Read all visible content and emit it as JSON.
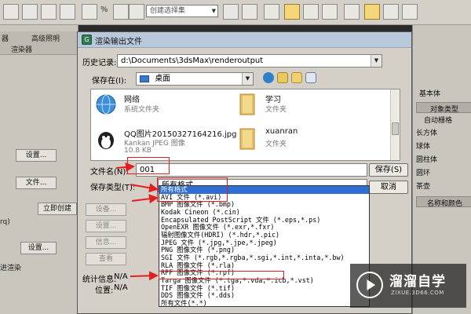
{
  "toolbar": {
    "selection_set_placeholder": "创建选择集",
    "percent_symbol": "%"
  },
  "left_panel": {
    "tab_render_setup": "器",
    "tab_advanced_lighting": "高级照明",
    "tab_renderer": "渲染器",
    "setup_button": "设置...",
    "files_button": "文件...",
    "render_now_button": "立即创建",
    "setup_button_2": "设置...",
    "label_rq": "rq)",
    "label_render": "进渲染"
  },
  "right_panel": {
    "section_basic": "基本体",
    "object_type": "对象类型",
    "auto_grid": "自动栅格",
    "items": [
      "长方体",
      "球体",
      "圆柱体",
      "圆环",
      "茶壶"
    ],
    "name_and_color": "名称和颜色"
  },
  "dialog": {
    "title": "渲染输出文件",
    "history_label": "历史记录:",
    "history_value": "d:\\Documents\\3dsMax\\renderoutput",
    "save_in_label": "保存在(I):",
    "save_in_value": "桌面",
    "files": [
      {
        "name": "网络",
        "sub1": "系统文件夹",
        "sub2": "",
        "icon": "globe-icon"
      },
      {
        "name": "学习",
        "sub1": "文件夹",
        "sub2": "",
        "icon": "folder-icon"
      },
      {
        "name": "QQ图片20150327164216.jpg",
        "sub1": "Kankan JPEG 图像",
        "sub2": "10.8 KB",
        "icon": "image-thumbnail-icon"
      },
      {
        "name": "xuanran",
        "sub1": "文件夹",
        "sub2": "",
        "icon": "folder-icon"
      }
    ],
    "filename_label": "文件名(N):",
    "filename_value": "001",
    "filetype_label": "保存类型(T):",
    "filetype_value": "所有格式",
    "save_button": "保存(S)",
    "cancel_button": "取消",
    "side_buttons": [
      "设备...",
      "设置...",
      "信息...",
      "查看"
    ],
    "stats_label": "统计信息:",
    "stats_value": "N/A",
    "location_label": "位置:",
    "location_value": "N/A"
  },
  "dropdown": {
    "selected_index": 0,
    "items": [
      "所有格式",
      "AVI 文件 (*.avi)",
      "BMP 图像文件 (*.bmp)",
      "Kodak Cineon (*.cin)",
      "Encapsulated PostScript 文件 (*.eps,*.ps)",
      "OpenEXR 图像文件 (*.exr,*.fxr)",
      "辐射图像文件(HDRI) (*.hdr,*.pic)",
      "JPEG 文件 (*.jpg,*.jpe,*.jpeg)",
      "PNG 图像文件 (*.png)",
      "SGI 文件 (*.rgb,*.rgba,*.sgi,*.int,*.inta,*.bw)",
      "RLA 图像文件 (*.rla)",
      "RPF 图像文件 (*.rpf)",
      "Targa 图像文件 (*.tga,*.vda,*.icb,*.vst)",
      "TIF 图像文件 (*.tif)",
      "DDS 图像文件 (*.dds)",
      "所有文件(*.*)"
    ]
  },
  "watermark": {
    "brand": "溜溜自学",
    "url": "ZIXUE.3D66.COM"
  },
  "colors": {
    "selection_blue": "#2f6fd1",
    "annotation_red": "#e02020",
    "dialog_bg": "#d4d0c8"
  }
}
